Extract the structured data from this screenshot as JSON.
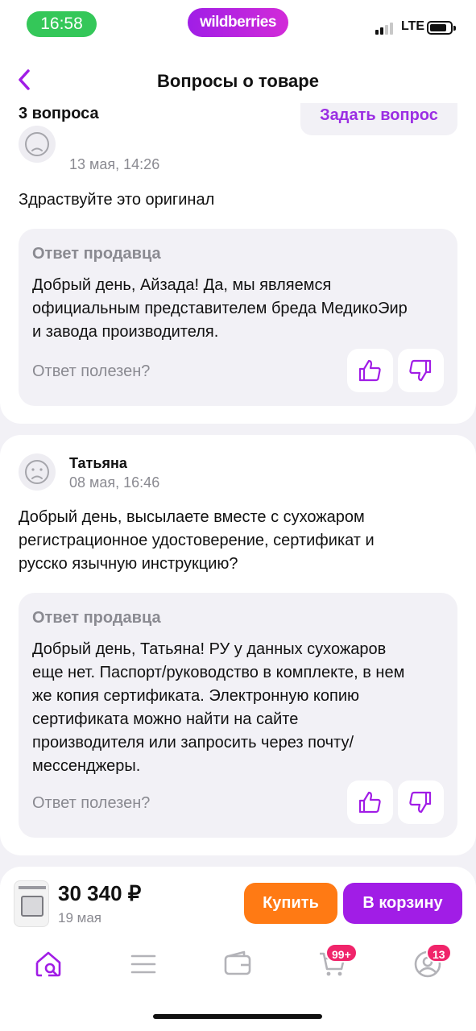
{
  "status": {
    "time": "16:58",
    "brand": "wildberries",
    "network": "LTE"
  },
  "header": {
    "title": "Вопросы о товаре",
    "count": "3 вопроса",
    "ask_label": "Задать вопрос"
  },
  "questions": [
    {
      "author": "",
      "date": "13 мая, 14:26",
      "text": "Здраствуйте это оригинал",
      "answer_label": "Ответ продавца",
      "answer_lines": [
        "Добрый день, Айзада! Да, мы являемся",
        "официальным представителем бреда МедикоЭир",
        "и завода производителя."
      ],
      "useful_label": "Ответ полезен?"
    },
    {
      "author": "Татьяна",
      "date": "08 мая, 16:46",
      "text_lines": [
        "Добрый день, высылаете вместе с сухожаром",
        "регистрационное удостоверение, сертификат и",
        "русско язычную инструкцию?"
      ],
      "answer_label": "Ответ продавца",
      "answer_lines": [
        "Добрый день, Татьяна! РУ у данных сухожаров",
        "еще нет. Паспорт/руководство в комплекте, в нем",
        "же копия сертификата. Электронную копию",
        "сертификата можно найти на сайте",
        "производителя или запросить через почту/",
        "мессенджеры."
      ],
      "useful_label": "Ответ полезен?"
    }
  ],
  "product": {
    "price": "30 340 ₽",
    "delivery": "19 мая",
    "buy_label": "Купить",
    "cart_label": "В корзину"
  },
  "tabbar": {
    "cart_badge": "99+",
    "profile_badge": "13"
  },
  "colors": {
    "accent": "#a11de6",
    "buy": "#ff7a14",
    "badge": "#f0246a"
  },
  "icons": [
    "back-chevron-icon",
    "avatar-placeholder-icon",
    "thumbs-up-icon",
    "thumbs-down-icon",
    "home-search-icon",
    "catalog-menu-icon",
    "wallet-icon",
    "cart-icon",
    "profile-icon"
  ]
}
